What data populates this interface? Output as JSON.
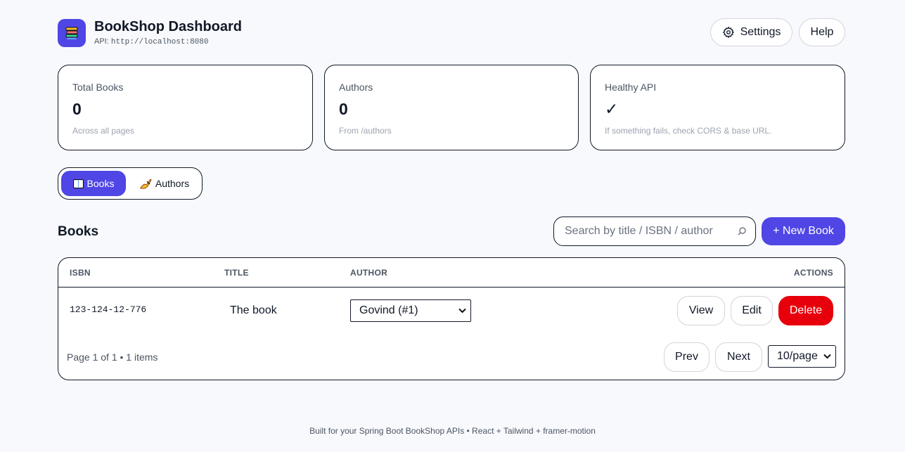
{
  "header": {
    "title": "BookShop Dashboard",
    "api_label": "API:",
    "api_url": "http://localhost:8080",
    "settings_label": "Settings",
    "help_label": "Help",
    "logo_icon": "books-stack-icon"
  },
  "stats": [
    {
      "label": "Total Books",
      "value": "0",
      "sub": "Across all pages"
    },
    {
      "label": "Authors",
      "value": "0",
      "sub": "From /authors"
    },
    {
      "label": "Healthy API",
      "value": "✓",
      "sub": "If something fails, check CORS & base URL."
    }
  ],
  "tabs": [
    {
      "label": "Books",
      "icon": "open-book-icon",
      "active": true
    },
    {
      "label": "Authors",
      "icon": "writing-hand-icon",
      "active": false
    }
  ],
  "section": {
    "title": "Books",
    "search_placeholder": "Search by title / ISBN / author",
    "new_button_label": "+ New Book"
  },
  "table": {
    "columns": [
      "ISBN",
      "TITLE",
      "AUTHOR",
      "ACTIONS"
    ],
    "rows": [
      {
        "isbn": "123-124-12-776",
        "title": "The book",
        "author": "Govind (#1)"
      }
    ],
    "actions": {
      "view": "View",
      "edit": "Edit",
      "delete": "Delete"
    }
  },
  "pagination": {
    "info": "Page 1 of 1 • 1 items",
    "prev_label": "Prev",
    "next_label": "Next",
    "per_page": "10/page"
  },
  "footer": {
    "text": "Built for your Spring Boot BookShop APIs • React + Tailwind + framer-motion"
  },
  "colors": {
    "accent": "#4f46e5",
    "danger": "#e7000b",
    "background": "#f8f9fc"
  }
}
